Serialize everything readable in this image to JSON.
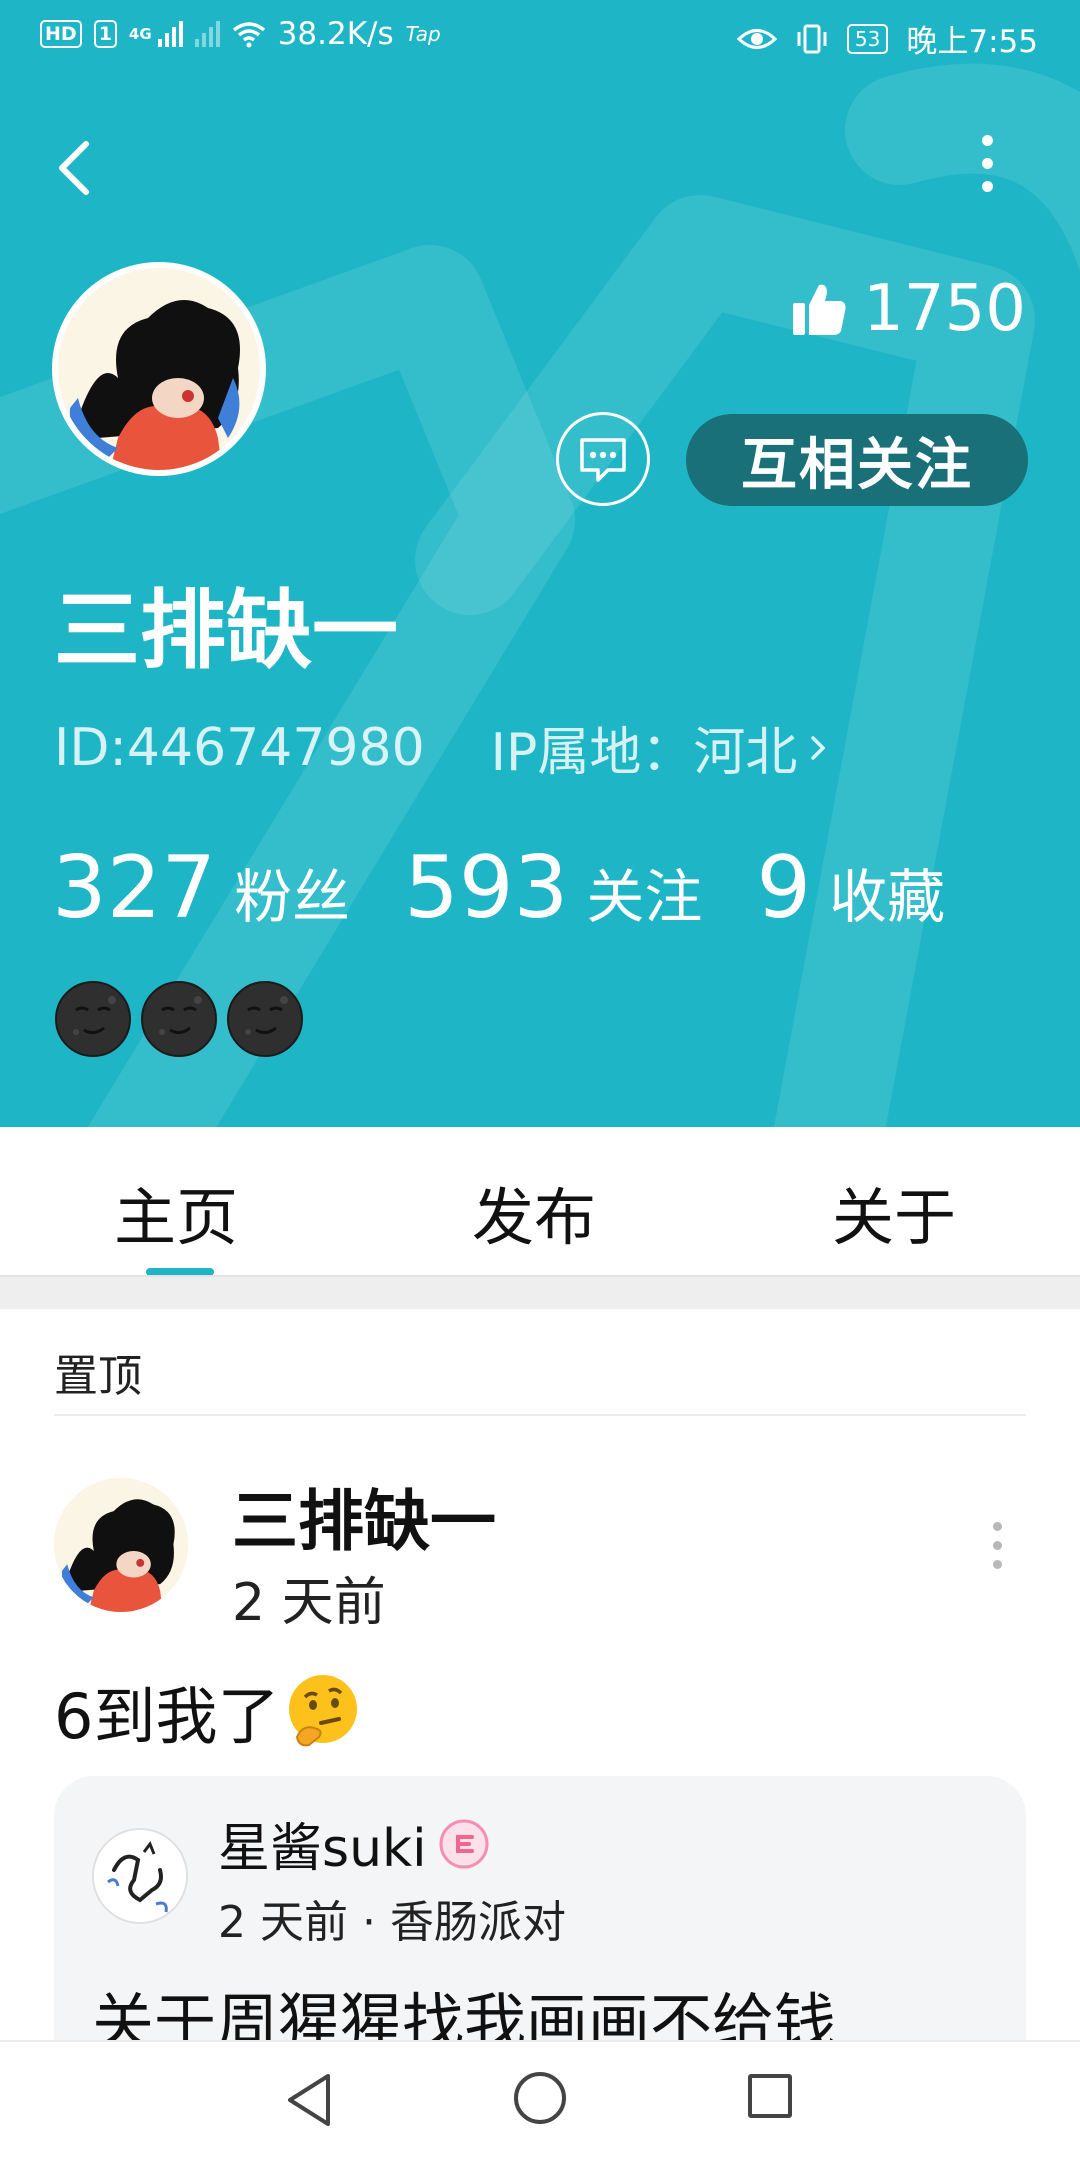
{
  "status_bar": {
    "hd_badge": "HD",
    "sim_slot": "1",
    "network": "4G",
    "speed": "38.2K/s",
    "tap_label": "Tap",
    "battery": "53",
    "time": "晚上7:55"
  },
  "profile": {
    "likes": "1750",
    "follow_button": "互相关注",
    "name": "三排缺一",
    "id_text": "ID:446747980",
    "ip_text": "IP属地：河北",
    "stats": [
      {
        "num": "327",
        "label": "粉丝"
      },
      {
        "num": "593",
        "label": "关注"
      },
      {
        "num": "9",
        "label": "收藏"
      }
    ],
    "badges": [
      "moon-face-icon",
      "moon-face-icon",
      "moon-face-icon"
    ]
  },
  "tabs": [
    {
      "label": "主页",
      "active": true
    },
    {
      "label": "发布",
      "active": false
    },
    {
      "label": "关于",
      "active": false
    }
  ],
  "feed": {
    "pinned_label": "置顶",
    "post": {
      "author": "三排缺一",
      "time": "2 天前",
      "text": "6到我了",
      "emoji": "thinking-face-icon",
      "repost": {
        "author": "星酱suki",
        "badge": "e-badge-icon",
        "meta": "2 天前 · 香肠派对",
        "title": "关于周猩猩找我画画不给钱"
      }
    }
  },
  "colors": {
    "header_bg": "#1eb6c6",
    "follow_button_bg": "#1a7078",
    "tab_indicator": "#1eb6c6"
  }
}
